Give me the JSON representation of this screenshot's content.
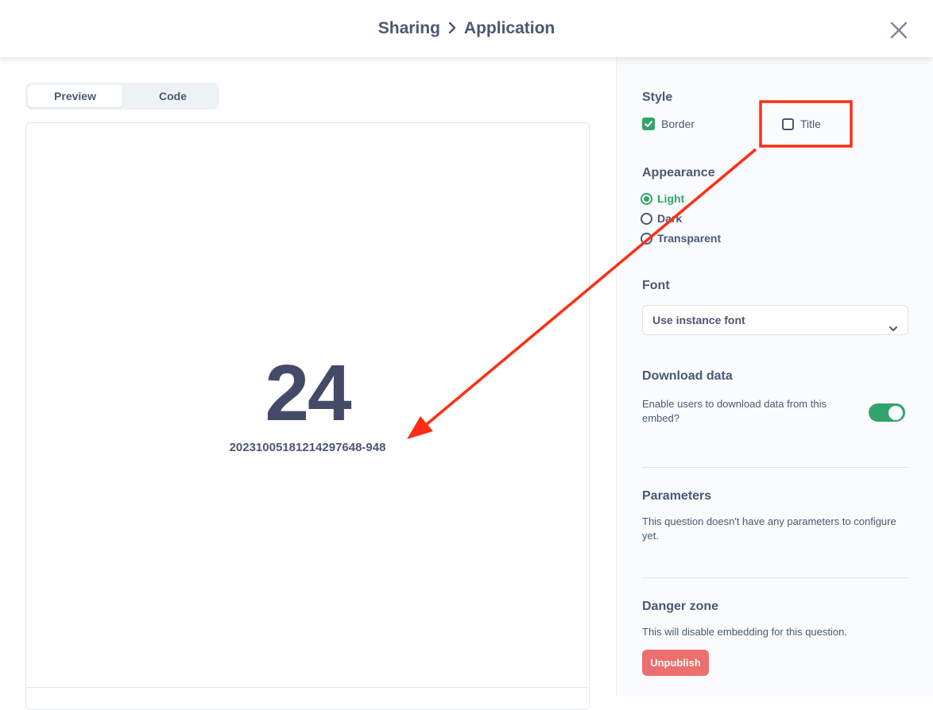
{
  "header": {
    "breadcrumb": {
      "parent": "Sharing",
      "current": "Application"
    }
  },
  "preview": {
    "tabs": [
      {
        "label": "Preview",
        "active": true
      },
      {
        "label": "Code",
        "active": false
      }
    ],
    "scalar": {
      "value": "24",
      "label": "20231005181214297648-948"
    }
  },
  "settings": {
    "style": {
      "title": "Style",
      "options": [
        {
          "label": "Border",
          "checked": true
        },
        {
          "label": "Title",
          "checked": false
        }
      ]
    },
    "appearance": {
      "title": "Appearance",
      "options": [
        {
          "label": "Light",
          "selected": true
        },
        {
          "label": "Dark",
          "selected": false
        },
        {
          "label": "Transparent",
          "selected": false
        }
      ]
    },
    "font": {
      "title": "Font",
      "value": "Use instance font"
    },
    "download": {
      "title": "Download data",
      "description": "Enable users to download data from this embed?",
      "enabled": true
    },
    "parameters": {
      "title": "Parameters",
      "description": "This question doesn't have any parameters to configure yet."
    },
    "danger": {
      "title": "Danger zone",
      "description": "This will disable embedding for this question.",
      "button": "Unpublish"
    }
  },
  "colors": {
    "accent": "#31a36c",
    "danger": "#ed6e6e",
    "text": "#4c5773",
    "annotation": "#ff2d16"
  }
}
